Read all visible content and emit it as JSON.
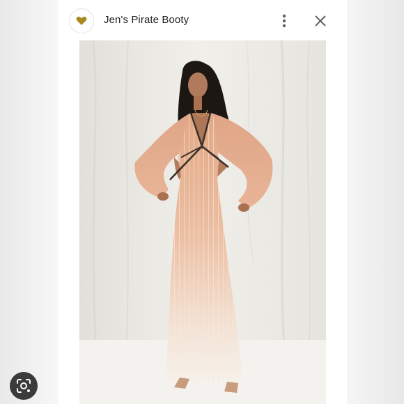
{
  "header": {
    "site_name": "Jen's Pirate Booty",
    "favicon_icon": "heart-icon",
    "more_icon": "more-vert-icon",
    "close_icon": "close-icon"
  },
  "image": {
    "icon": "product-photo"
  },
  "lens": {
    "icon": "lens-search-icon"
  },
  "colors": {
    "favicon_heart": "#a8891e",
    "icon_gray": "#5f6368",
    "lens_bg": "#3b3b3b"
  }
}
